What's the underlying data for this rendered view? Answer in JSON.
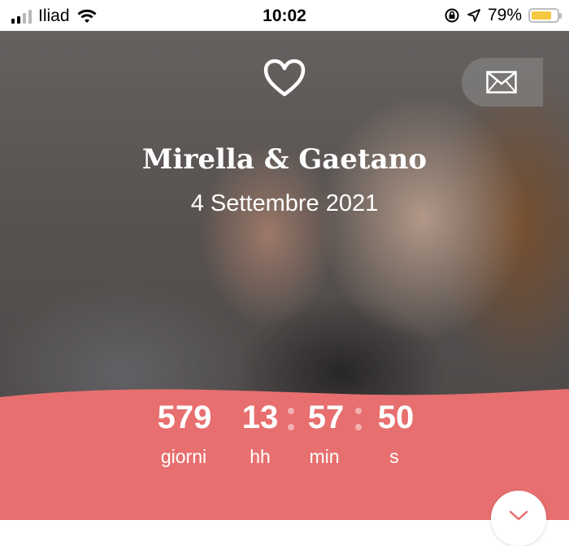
{
  "status_bar": {
    "carrier": "Iliad",
    "time": "10:02",
    "battery_percent": "79%",
    "battery_level": 0.79,
    "signal_bars_on": 2,
    "icons": [
      "signal-icon",
      "wifi-icon",
      "orientation-lock-icon",
      "location-arrow-icon",
      "battery-icon"
    ]
  },
  "hero": {
    "names": "Mirella & Gaetano",
    "date": "4 Settembre 2021",
    "icons": [
      "heart-icon",
      "envelope-icon"
    ]
  },
  "countdown": {
    "days_value": "579",
    "days_label": "giorni",
    "hours_value": "13",
    "hours_label": "hh",
    "minutes_value": "57",
    "minutes_label": "min",
    "seconds_value": "50",
    "seconds_label": "s",
    "background_color": "#e86f6f",
    "separator_color": "#f3b1b1"
  },
  "scroll": {
    "icon": "chevron-down-icon"
  }
}
